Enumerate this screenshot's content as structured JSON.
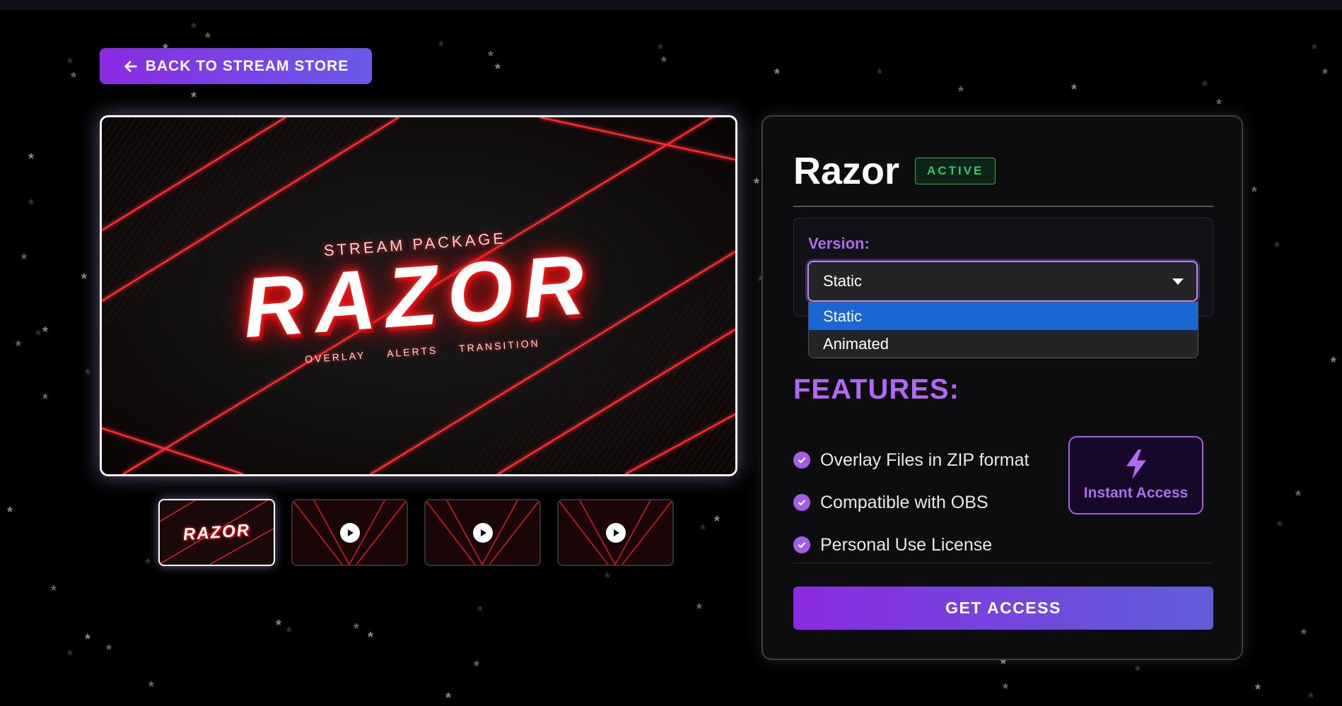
{
  "nav": {
    "back_label": "BACK TO STREAM STORE",
    "back_icon": "arrow-left-icon"
  },
  "hero": {
    "subtitle": "STREAM PACKAGE",
    "name": "RAZOR",
    "tags": [
      "OVERLAY",
      "ALERTS",
      "TRANSITION"
    ]
  },
  "thumbnails": [
    {
      "kind": "image",
      "label": "RAZOR",
      "active": true
    },
    {
      "kind": "video",
      "icon": "play-icon",
      "active": false
    },
    {
      "kind": "video",
      "icon": "play-icon",
      "active": false
    },
    {
      "kind": "video",
      "icon": "play-icon",
      "active": false
    }
  ],
  "product": {
    "title": "Razor",
    "status": "ACTIVE",
    "version_label": "Version:",
    "version_selected": "Static",
    "version_options": [
      "Static",
      "Animated"
    ]
  },
  "features": {
    "heading": "FEATURES:",
    "items": [
      "Overlay Files in ZIP format",
      "Compatible with OBS",
      "Personal Use License"
    ],
    "badge_label": "Instant Access",
    "badge_icon": "lightning-bolt-icon"
  },
  "cta": {
    "label": "GET ACCESS"
  },
  "colors": {
    "accent_purple": "#b069f2",
    "status_green": "#35c46b",
    "selected_option_blue": "#1a66d2",
    "hero_red": "#ff2a2a"
  }
}
